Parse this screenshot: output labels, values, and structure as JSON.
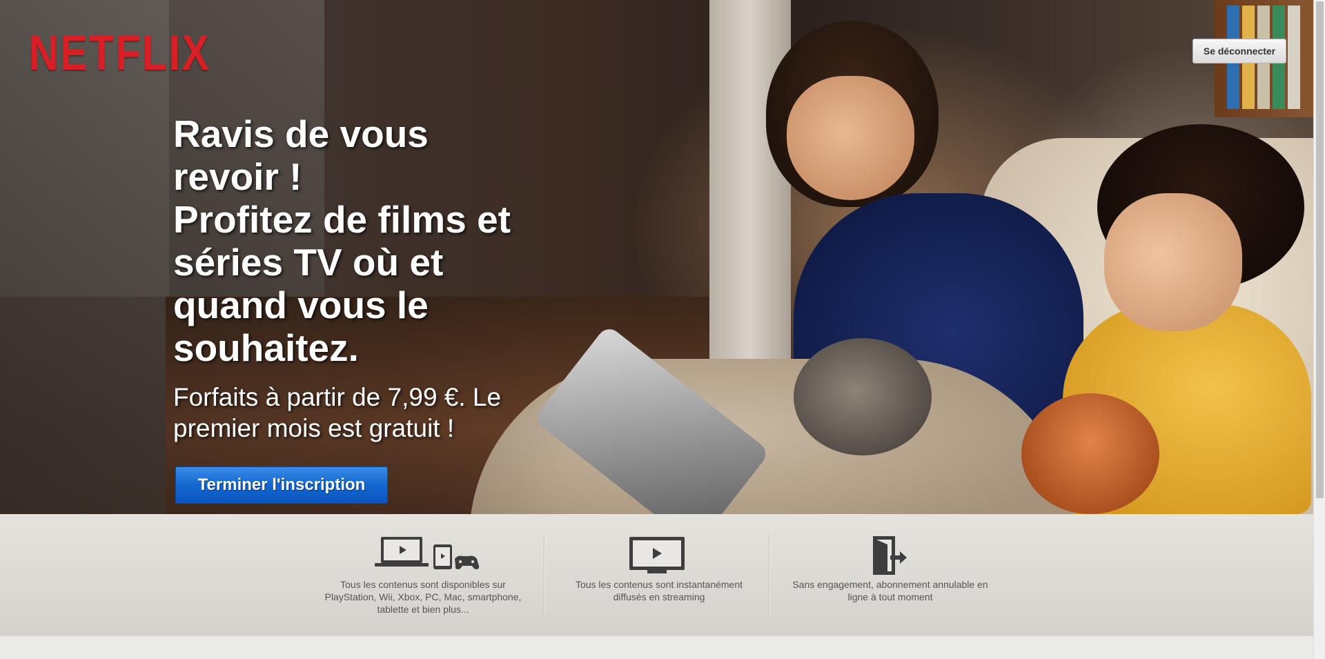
{
  "header": {
    "logo_text": "NETFLIX",
    "logout_label": "Se déconnecter"
  },
  "hero": {
    "headline_lines": [
      "Ravis de vous",
      "revoir !",
      "Profitez de films et",
      "séries TV où et",
      "quand vous le",
      "souhaitez."
    ],
    "subline_lines": [
      "Forfaits à partir de 7,99 €. Le",
      "premier mois est gratuit !"
    ],
    "cta_label": "Terminer l'inscription"
  },
  "features": [
    {
      "icon": "devices-icon",
      "lines": [
        "Tous les contenus sont disponibles sur",
        "PlayStation, Wii, Xbox, PC, Mac, smartphone,",
        "tablette et bien plus..."
      ]
    },
    {
      "icon": "tv-play-icon",
      "lines": [
        "Tous les contenus sont instantanément",
        "diffusés en streaming"
      ]
    },
    {
      "icon": "exit-door-icon",
      "lines": [
        "Sans engagement, abonnement annulable en",
        "ligne à tout moment"
      ]
    }
  ],
  "colors": {
    "brand_red": "#d81f26",
    "cta_blue": "#1466d0"
  }
}
